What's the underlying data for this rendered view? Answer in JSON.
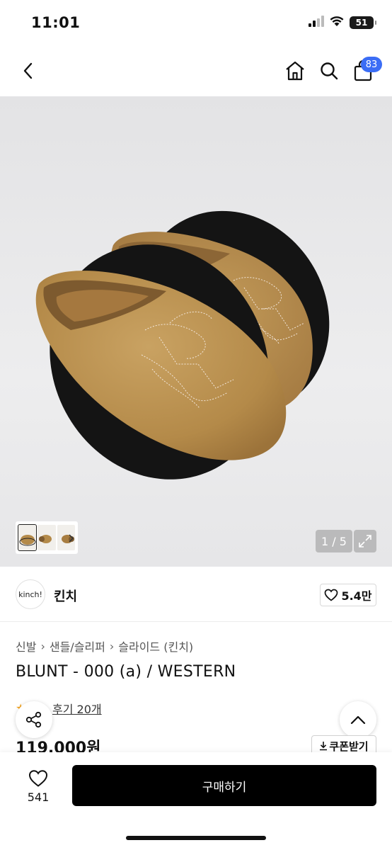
{
  "status_bar": {
    "time": "11:01",
    "battery": "51"
  },
  "nav": {
    "cart_count": "83"
  },
  "gallery": {
    "counter": "1 / 5"
  },
  "brand": {
    "logo_text": "kinch!",
    "name": "킨치",
    "likes": "5.4만"
  },
  "breadcrumb": [
    "신발",
    "샌들/슬리퍼",
    "슬라이드 (킨치)"
  ],
  "product": {
    "title": "BLUNT - 000 (a) / WESTERN",
    "reviews": "후기 20개",
    "price": "119,000원"
  },
  "coupon": {
    "label": "쿠폰받기"
  },
  "bottom": {
    "wish_count": "541",
    "buy_label": "구매하기"
  },
  "colors": {
    "accent": "#3b6df5",
    "suede": "#b98f4f",
    "button": "#000000"
  }
}
